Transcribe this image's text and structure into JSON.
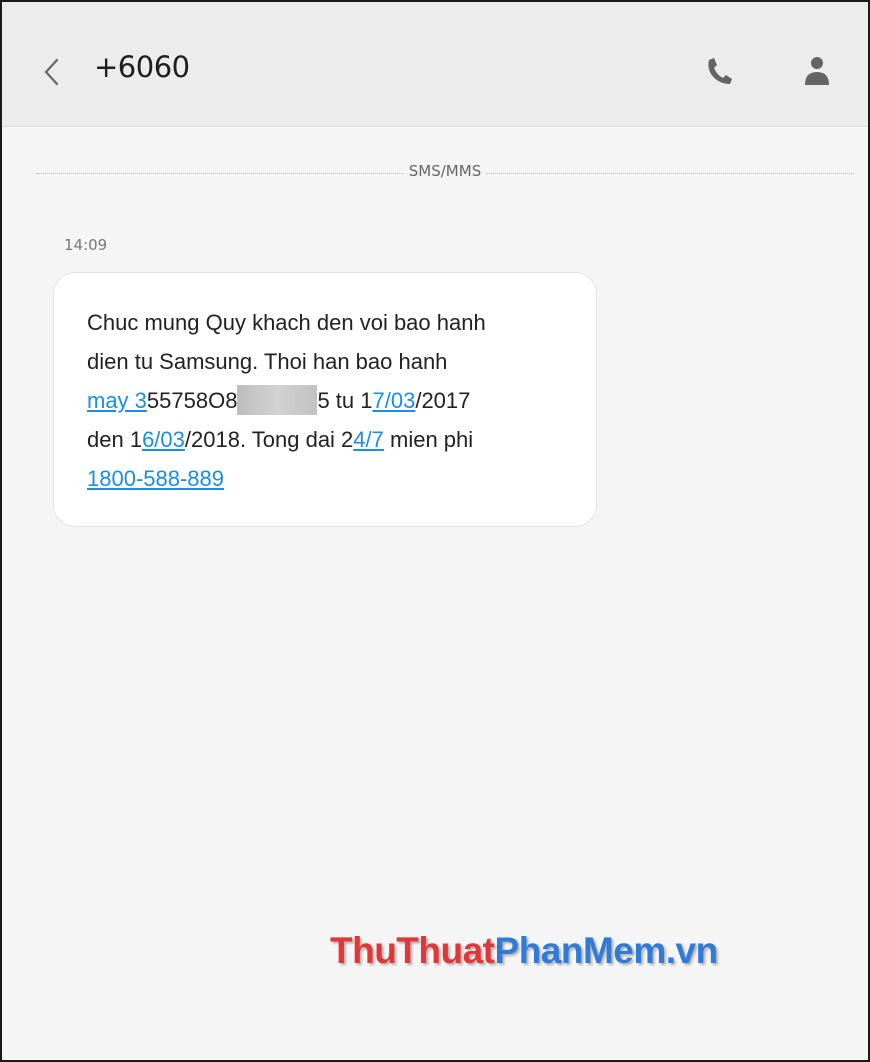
{
  "header": {
    "title": "+6060",
    "icons": {
      "back": "chevron-left-icon",
      "call": "phone-icon",
      "contact": "person-icon"
    }
  },
  "thread": {
    "channel_label": "SMS/MMS",
    "messages": [
      {
        "time": "14:09",
        "lines": [
          [
            "Chuc mung Quy khach den voi bao hanh"
          ],
          [
            "dien tu Samsung. Thoi han bao hanh"
          ],
          [
            "may 3",
            "55758O8",
            "5 tu 1",
            "7/03",
            "/2017"
          ],
          [
            "den 1",
            "6/03",
            "/2018. Tong dai 2",
            "4/7",
            " mien phi"
          ],
          [
            "1800-588-889"
          ]
        ]
      }
    ]
  },
  "watermark": {
    "part1": "ThuThuat",
    "part2": "PhanMem.vn"
  },
  "colors": {
    "link": "#1a8de4",
    "header_bg": "#ececec",
    "background": "#f5f5f5"
  }
}
